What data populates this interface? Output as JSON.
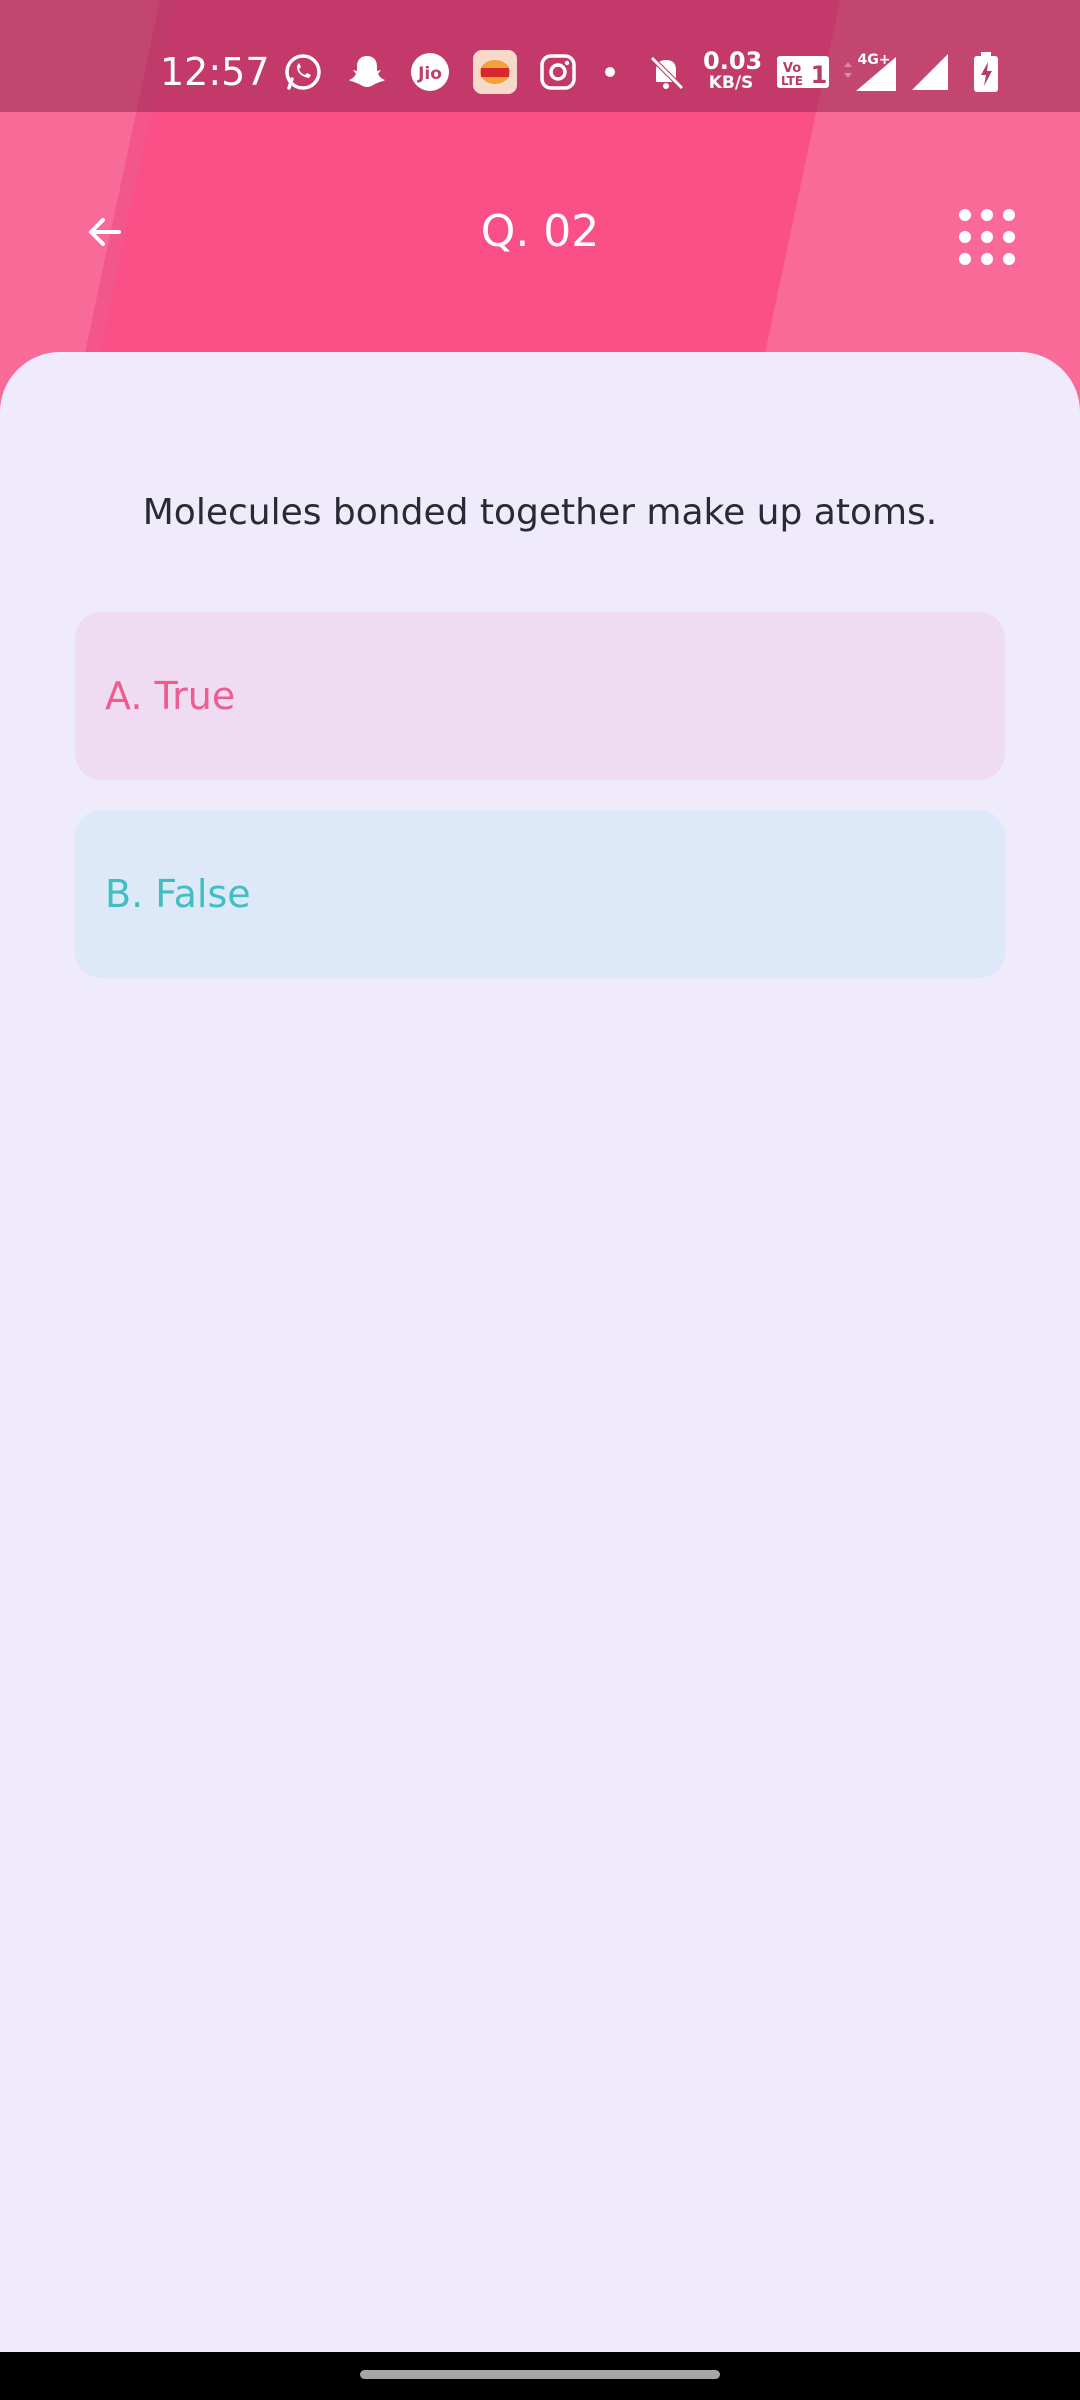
{
  "status_bar": {
    "time": "12:57",
    "speed_value": "0.03",
    "speed_unit": "KB/S",
    "network_label": "4G+",
    "volte_label": "Vo LTE 1",
    "icons": [
      "whatsapp-icon",
      "snapchat-icon",
      "jio-icon",
      "burger-king-icon",
      "instagram-icon",
      "dot-icon",
      "bell-muted-icon",
      "volte-icon",
      "signal-4g-icon",
      "signal-icon",
      "battery-charging-icon"
    ]
  },
  "app_bar": {
    "title": "Q. 02",
    "back_icon": "arrow-left-icon",
    "grid_icon": "grid-dots-icon"
  },
  "question": {
    "text": "Molecules bonded together make up atoms."
  },
  "options": [
    {
      "label": "A. True",
      "color": "#ee5d8f",
      "bg": "#f0dcf2"
    },
    {
      "label": "B. False",
      "color": "#3fbfc2",
      "bg": "#dde8f9"
    }
  ],
  "colors": {
    "header": "#fb4f87",
    "background": "#efebfb"
  }
}
